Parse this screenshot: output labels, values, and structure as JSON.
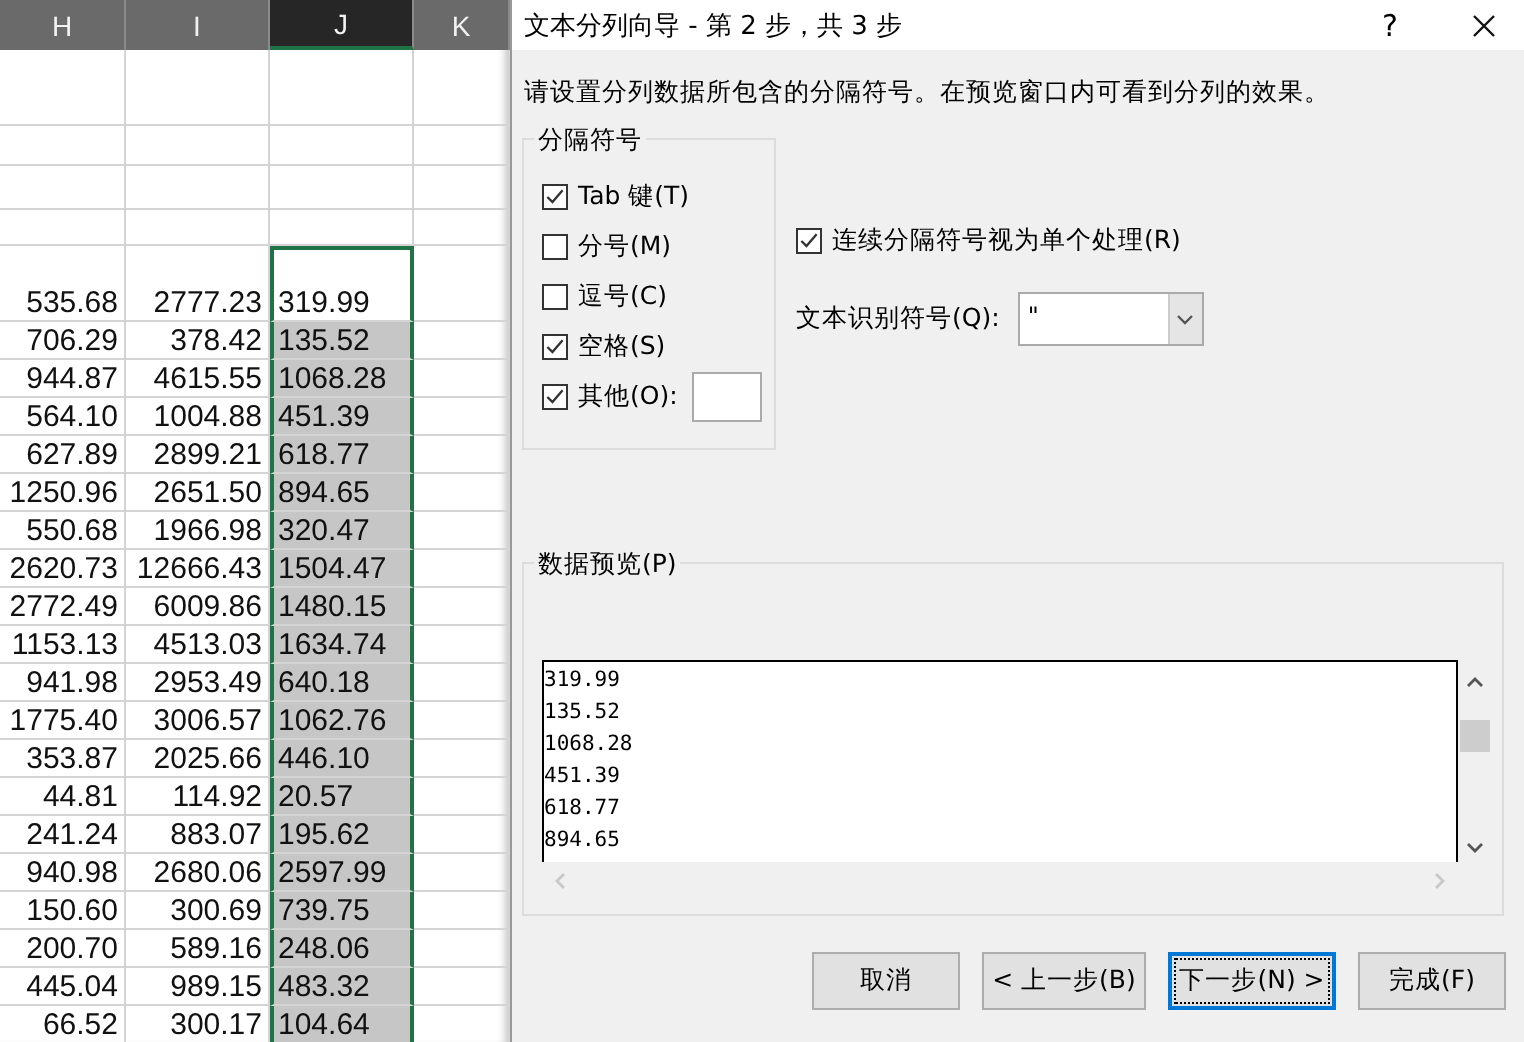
{
  "sheet": {
    "columns": [
      {
        "label": "H",
        "selected": false
      },
      {
        "label": "I",
        "selected": false
      },
      {
        "label": "J",
        "selected": true
      },
      {
        "label": "K",
        "selected": false
      }
    ],
    "rows": [
      {
        "h": "535.68",
        "i": "2777.23",
        "j": "319.99",
        "active": true
      },
      {
        "h": "706.29",
        "i": "378.42",
        "j": "135.52",
        "active": false
      },
      {
        "h": "944.87",
        "i": "4615.55",
        "j": "1068.28",
        "active": false
      },
      {
        "h": "564.10",
        "i": "1004.88",
        "j": "451.39",
        "active": false
      },
      {
        "h": "627.89",
        "i": "2899.21",
        "j": "618.77",
        "active": false
      },
      {
        "h": "1250.96",
        "i": "2651.50",
        "j": "894.65",
        "active": false
      },
      {
        "h": "550.68",
        "i": "1966.98",
        "j": "320.47",
        "active": false
      },
      {
        "h": "2620.73",
        "i": "12666.43",
        "j": "1504.47",
        "active": false
      },
      {
        "h": "2772.49",
        "i": "6009.86",
        "j": "1480.15",
        "active": false
      },
      {
        "h": "1153.13",
        "i": "4513.03",
        "j": "1634.74",
        "active": false
      },
      {
        "h": "941.98",
        "i": "2953.49",
        "j": "640.18",
        "active": false
      },
      {
        "h": "1775.40",
        "i": "3006.57",
        "j": "1062.76",
        "active": false
      },
      {
        "h": "353.87",
        "i": "2025.66",
        "j": "446.10",
        "active": false
      },
      {
        "h": "44.81",
        "i": "114.92",
        "j": "20.57",
        "active": false
      },
      {
        "h": "241.24",
        "i": "883.07",
        "j": "195.62",
        "active": false
      },
      {
        "h": "940.98",
        "i": "2680.06",
        "j": "2597.99",
        "active": false
      },
      {
        "h": "150.60",
        "i": "300.69",
        "j": "739.75",
        "active": false
      },
      {
        "h": "200.70",
        "i": "589.16",
        "j": "248.06",
        "active": false
      },
      {
        "h": "445.04",
        "i": "989.15",
        "j": "483.32",
        "active": false
      },
      {
        "h": "66.52",
        "i": "300.17",
        "j": "104.64",
        "active": false
      }
    ]
  },
  "dialog": {
    "title": "文本分列向导 - 第 2 步，共 3 步",
    "help": "?",
    "instruction": "请设置分列数据所包含的分隔符号。在预览窗口内可看到分列的效果。",
    "delimiters": {
      "legend": "分隔符号",
      "items": [
        {
          "label": "Tab 键(T)",
          "checked": true,
          "kind": "plain"
        },
        {
          "label": "分号(M)",
          "checked": false,
          "kind": "plain"
        },
        {
          "label": "逗号(C)",
          "checked": false,
          "kind": "plain"
        },
        {
          "label": "空格(S)",
          "checked": true,
          "kind": "plain"
        },
        {
          "label": "其他(O):",
          "checked": true,
          "kind": "with-input"
        }
      ]
    },
    "consecutive": {
      "label": "连续分隔符号视为单个处理(R)",
      "checked": true
    },
    "qualifier": {
      "label": "文本识别符号(Q):",
      "value": "\""
    },
    "preview": {
      "legend": "数据预览(P)",
      "lines": [
        "319.99",
        "135.52",
        "1068.28",
        "451.39",
        "618.77",
        "894.65"
      ]
    },
    "buttons": [
      {
        "label": "取消",
        "default": false
      },
      {
        "label": "< 上一步(B)",
        "default": false
      },
      {
        "label": "下一步(N) >",
        "default": true
      },
      {
        "label": "完成(F)",
        "default": false
      }
    ]
  }
}
